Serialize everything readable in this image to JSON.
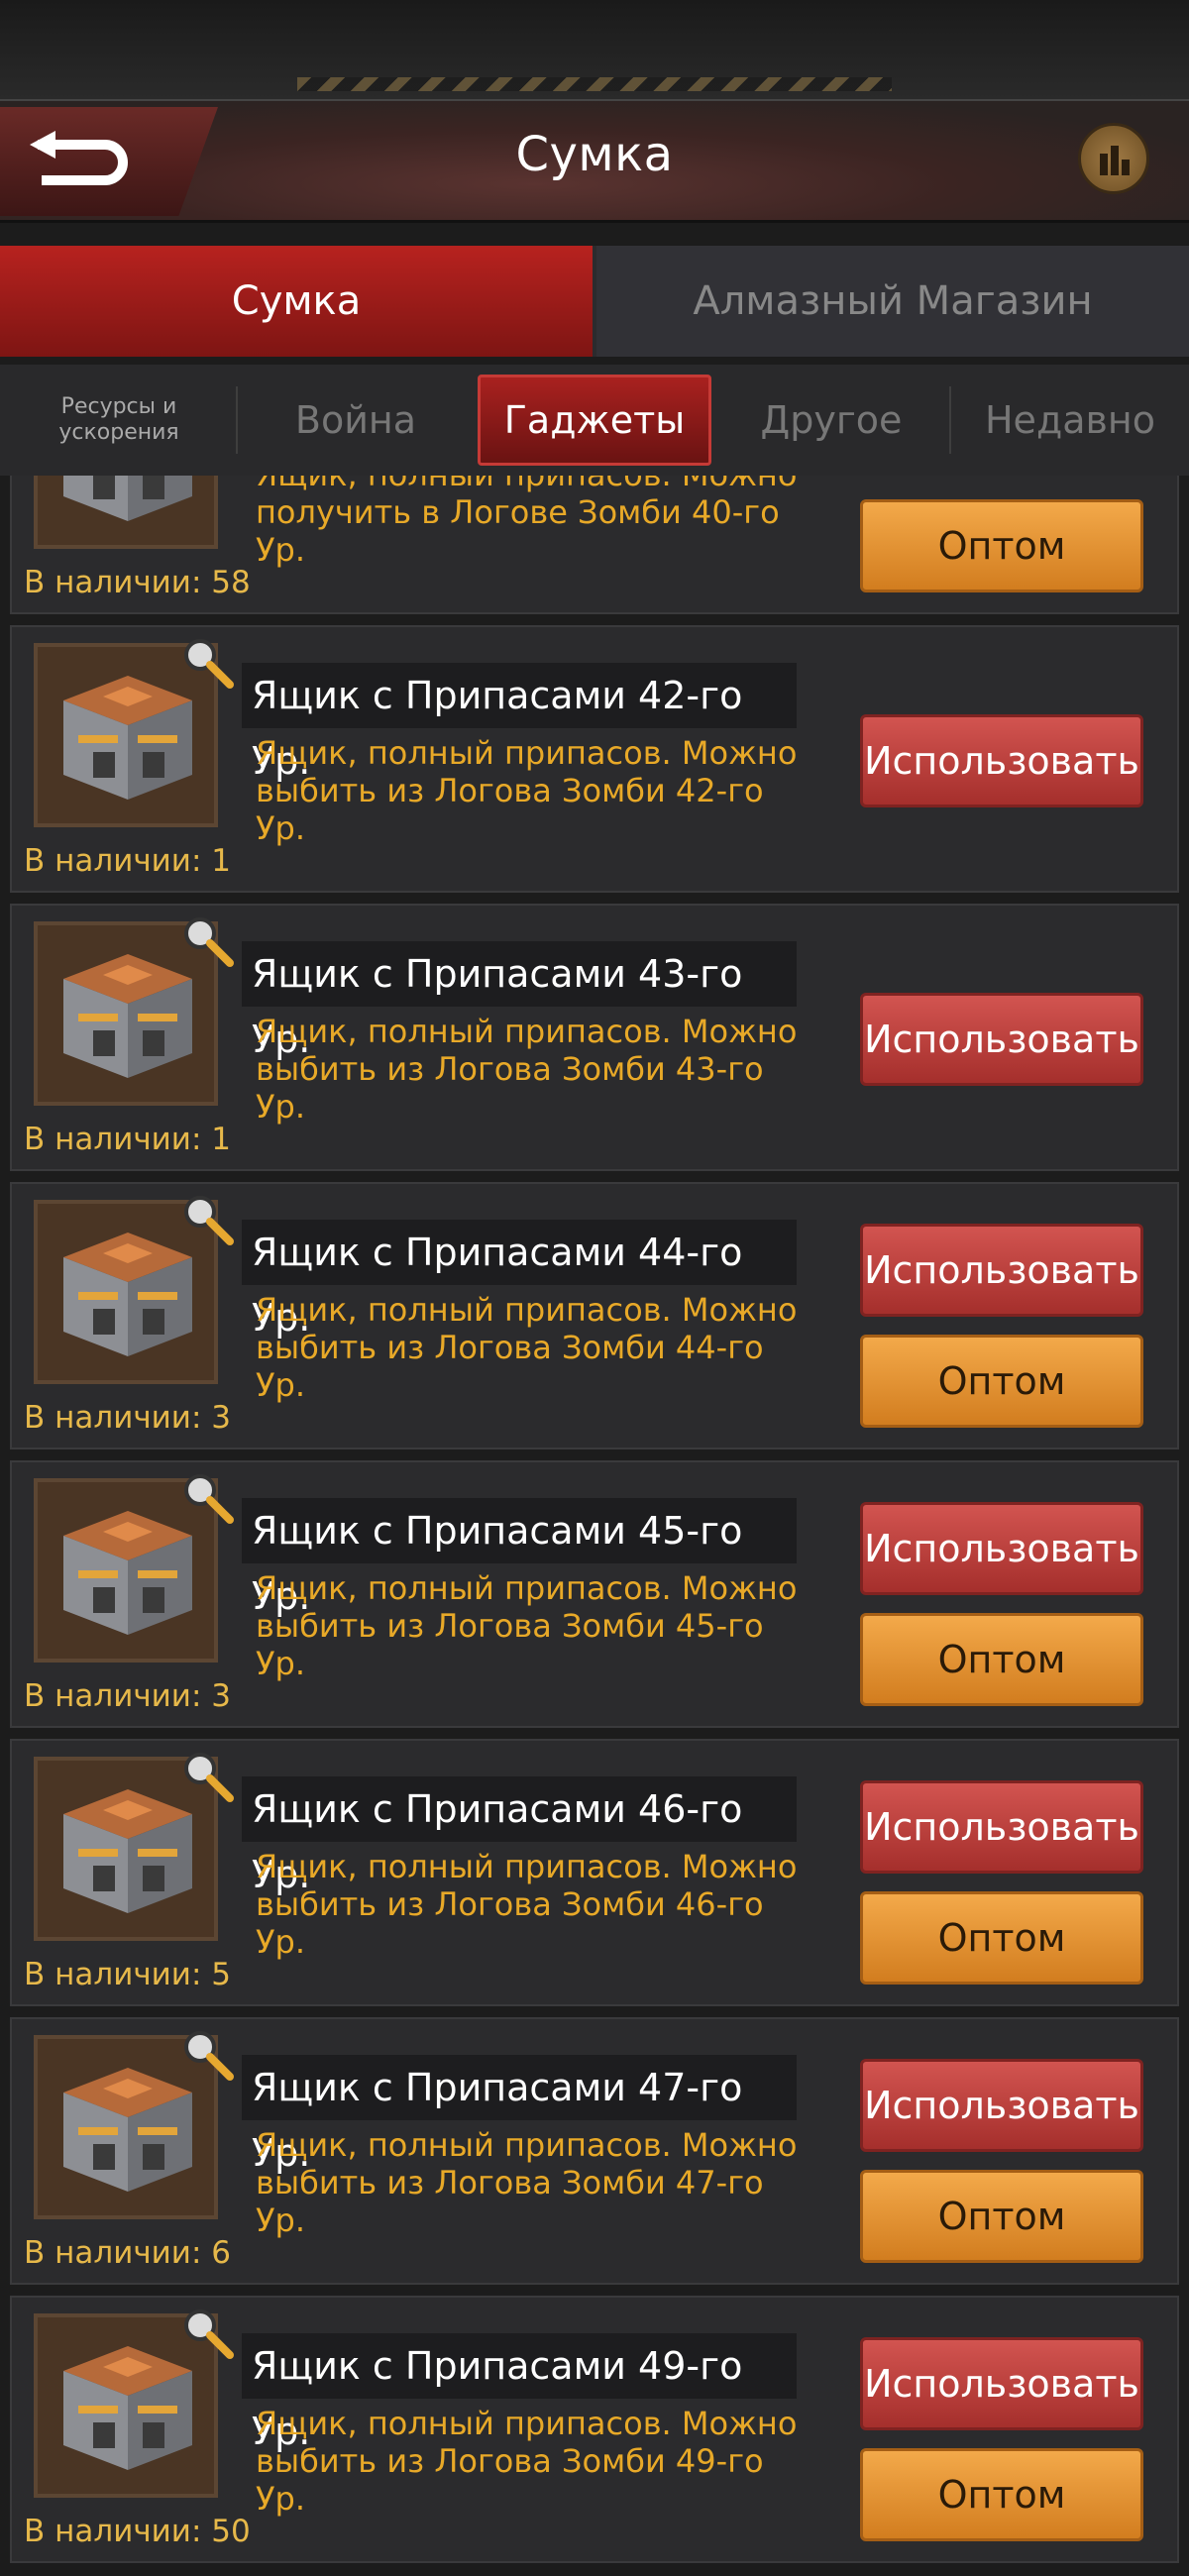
{
  "header": {
    "title": "Сумка"
  },
  "tabs": [
    {
      "label": "Сумка",
      "active": true
    },
    {
      "label": "Алмазный Магазин",
      "active": false
    }
  ],
  "subtabs": [
    {
      "label": "Ресурсы и ускорения"
    },
    {
      "label": "Война"
    },
    {
      "label": "Гаджеты",
      "active": true
    },
    {
      "label": "Другое"
    },
    {
      "label": "Недавно"
    }
  ],
  "colors": {
    "accent": "#b7221f",
    "gold_text": "#e8a928",
    "use_button": "#c7433f",
    "bulk_button": "#e6962e"
  },
  "items": [
    {
      "name": "",
      "desc_line1": "Ящик, полный припасов. Можно",
      "desc_line2": "получить в Логове Зомби 40-го",
      "desc_line3": "Ур.",
      "stock": "В наличии: 58",
      "use_label": "",
      "bulk_label": "Оптом"
    },
    {
      "name": "Ящик с Припасами 42-го Ур.",
      "desc_line1": "Ящик, полный припасов. Можно",
      "desc_line2": "выбить из Логова Зомби 42-го",
      "desc_line3": "Ур.",
      "stock": "В наличии: 1",
      "use_label": "Использовать",
      "bulk_label": ""
    },
    {
      "name": "Ящик с Припасами 43-го Ур.",
      "desc_line1": "Ящик, полный припасов. Можно",
      "desc_line2": "выбить из Логова Зомби 43-го",
      "desc_line3": "Ур.",
      "stock": "В наличии: 1",
      "use_label": "Использовать",
      "bulk_label": ""
    },
    {
      "name": "Ящик с Припасами 44-го Ур.",
      "desc_line1": "Ящик, полный припасов. Можно",
      "desc_line2": "выбить из Логова Зомби 44-го",
      "desc_line3": "Ур.",
      "stock": "В наличии: 3",
      "use_label": "Использовать",
      "bulk_label": "Оптом"
    },
    {
      "name": "Ящик с Припасами 45-го Ур.",
      "desc_line1": "Ящик, полный припасов. Можно",
      "desc_line2": "выбить из Логова Зомби 45-го",
      "desc_line3": "Ур.",
      "stock": "В наличии: 3",
      "use_label": "Использовать",
      "bulk_label": "Оптом"
    },
    {
      "name": "Ящик с Припасами 46-го Ур.",
      "desc_line1": "Ящик, полный припасов. Можно",
      "desc_line2": "выбить из Логова Зомби 46-го",
      "desc_line3": "Ур.",
      "stock": "В наличии: 5",
      "use_label": "Использовать",
      "bulk_label": "Оптом"
    },
    {
      "name": "Ящик с Припасами 47-го Ур.",
      "desc_line1": "Ящик, полный припасов. Можно",
      "desc_line2": "выбить из Логова Зомби 47-го",
      "desc_line3": "Ур.",
      "stock": "В наличии: 6",
      "use_label": "Использовать",
      "bulk_label": "Оптом"
    },
    {
      "name": "Ящик с Припасами 49-го Ур.",
      "desc_line1": "Ящик, полный припасов. Можно",
      "desc_line2": "выбить из Логова Зомби 49-го",
      "desc_line3": "Ур.",
      "stock": "В наличии: 50",
      "use_label": "Использовать",
      "bulk_label": "Оптом"
    }
  ]
}
